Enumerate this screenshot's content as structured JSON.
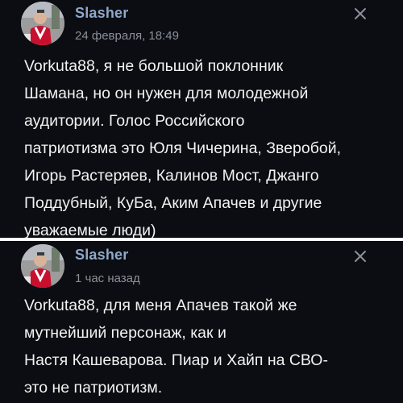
{
  "comments": [
    {
      "username": "Slasher",
      "timestamp": "24 февраля, 18:49",
      "text": "Vorkuta88, я не большой поклонник\nШамана, но он нужен для молодежной\nаудитории. Голос Российского\nпатриотизма это Юля Чичерина, Зверобой,\nИгорь Растеряев, Калинов Мост, Джанго\nПоддубный, КуБа, Аким Апачев и другие\nуважаемые люди)"
    },
    {
      "username": "Slasher",
      "timestamp": "1 час назад",
      "text": "Vorkuta88, для меня Апачев такой же\nмутнейший персонаж, как и\nНастя Кашеварова. Пиар и Хайп на СВО-\nэто не патриотизм."
    }
  ],
  "icons": {
    "close": "close-icon",
    "avatar": "avatar"
  },
  "colors": {
    "background": "#0b0d12",
    "username": "#8fa8c8",
    "timestamp": "#8a8f99",
    "text": "#f2f2f2",
    "divider": "#ffffff"
  }
}
